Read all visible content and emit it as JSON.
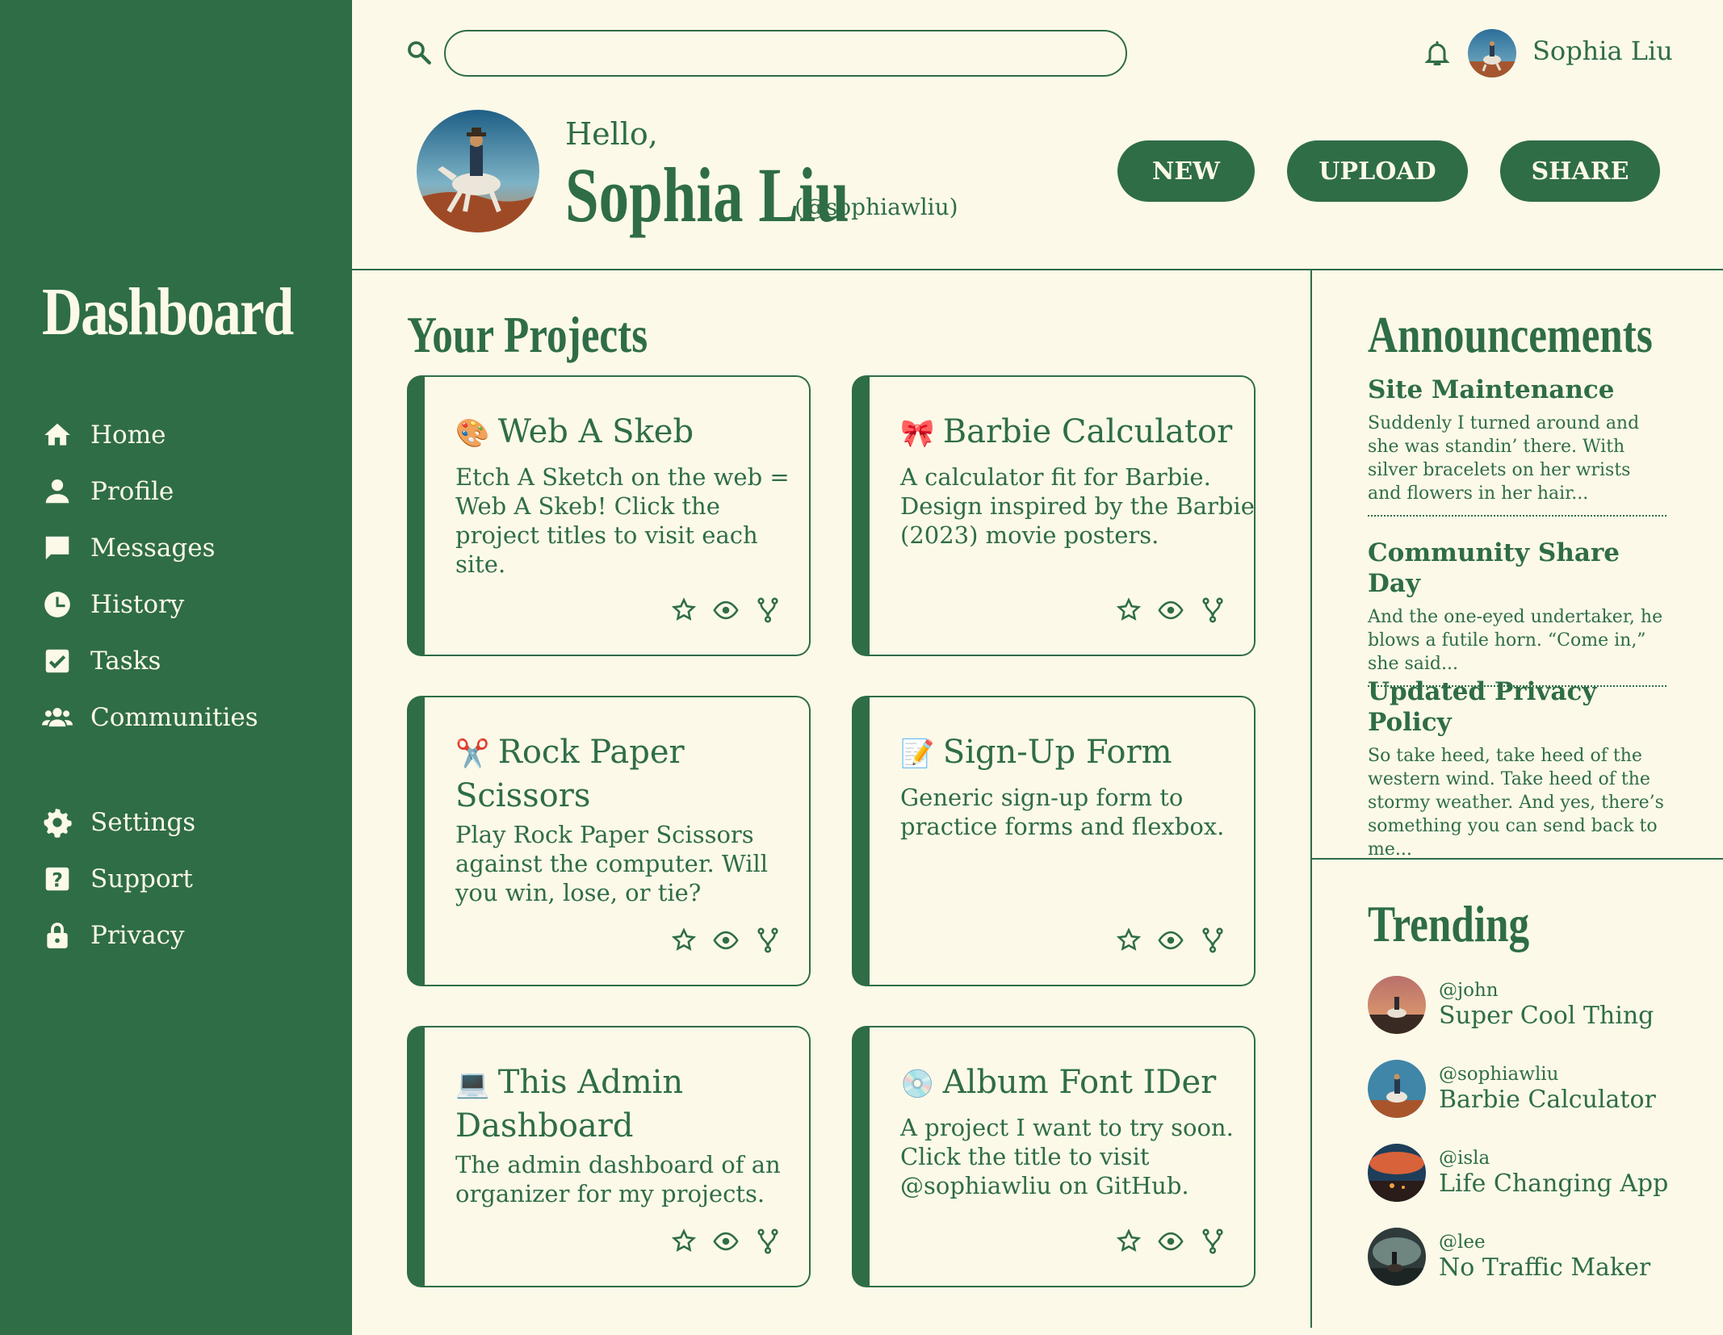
{
  "sidebar": {
    "brand": "Dashboard",
    "nav_main": [
      {
        "label": "Home",
        "icon": "home-icon"
      },
      {
        "label": "Profile",
        "icon": "user-icon"
      },
      {
        "label": "Messages",
        "icon": "chat-bubble-icon"
      },
      {
        "label": "History",
        "icon": "clock-icon"
      },
      {
        "label": "Tasks",
        "icon": "checkbox-icon"
      },
      {
        "label": "Communities",
        "icon": "group-icon"
      }
    ],
    "nav_secondary": [
      {
        "label": "Settings",
        "icon": "gear-icon"
      },
      {
        "label": "Support",
        "icon": "question-icon"
      },
      {
        "label": "Privacy",
        "icon": "lock-icon"
      }
    ]
  },
  "header": {
    "search_placeholder": "",
    "user_name": "Sophia Liu",
    "greeting": "Hello,",
    "display_name": "Sophia Liu",
    "handle": "(@sophiawliu)",
    "buttons": {
      "new": "NEW",
      "upload": "UPLOAD",
      "share": "SHARE"
    }
  },
  "projects": {
    "title": "Your Projects",
    "items": [
      {
        "emoji": "🎨",
        "title": "Web A Skeb",
        "desc": "Etch A Sketch on the web = Web A Skeb! Click the project titles to visit each site."
      },
      {
        "emoji": "🎀",
        "title": "Barbie Calculator",
        "desc": "A calculator fit for Barbie. Design inspired by the Barbie (2023) movie posters."
      },
      {
        "emoji": "✂️",
        "title": "Rock Paper Scissors",
        "desc": "Play Rock Paper Scissors against the computer. Will you win, lose, or tie?"
      },
      {
        "emoji": "📝",
        "title": "Sign-Up Form",
        "desc": "Generic sign-up form to practice forms and flexbox."
      },
      {
        "emoji": "💻",
        "title": "This Admin Dashboard",
        "desc": "The admin dashboard of an organizer for my projects."
      },
      {
        "emoji": "💿",
        "title": "Album Font IDer",
        "desc": "A project I want to try soon. Click the title to visit @sophiawliu on GitHub."
      }
    ]
  },
  "announcements": {
    "title": "Announcements",
    "items": [
      {
        "title": "Site Maintenance",
        "body": "Suddenly I turned around and she was standin’ there. With silver bracelets on her wrists and flowers in her hair..."
      },
      {
        "title": "Community Share Day",
        "body": "And the one-eyed undertaker, he blows a futile horn. “Come in,” she said..."
      },
      {
        "title": "Updated Privacy Policy",
        "body": "So take heed, take heed of the western wind. Take heed of the stormy weather. And yes, there’s something you can send back to me..."
      }
    ]
  },
  "trending": {
    "title": "Trending",
    "items": [
      {
        "user": "@john",
        "name": "Super Cool Thing"
      },
      {
        "user": "@sophiawliu",
        "name": "Barbie Calculator"
      },
      {
        "user": "@isla",
        "name": "Life Changing App"
      },
      {
        "user": "@lee",
        "name": "No Traffic Maker"
      }
    ]
  },
  "colors": {
    "primary": "#2f6d46",
    "background": "#fcf9e9"
  }
}
